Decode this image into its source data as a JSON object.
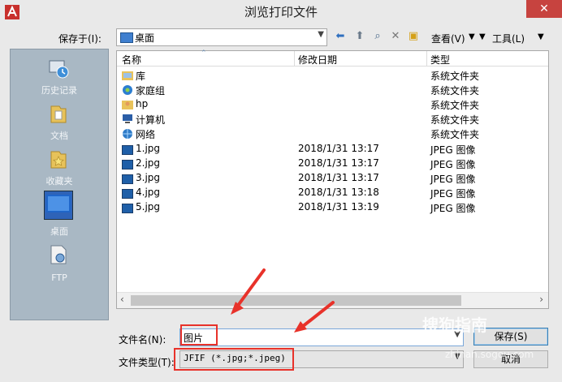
{
  "window": {
    "title": "浏览打印文件",
    "close_glyph": "✕"
  },
  "toolbar": {
    "save_in_label": "保存于(I):",
    "save_in_value": "桌面",
    "view_label": "查看(V)",
    "tools_label": "工具(L)",
    "icons": [
      "back-icon",
      "up-folder-icon",
      "search-web-icon",
      "delete-icon",
      "new-folder-icon"
    ]
  },
  "places": [
    {
      "label": "历史记录",
      "icon": "history-icon"
    },
    {
      "label": "文档",
      "icon": "documents-folder-icon"
    },
    {
      "label": "收藏夹",
      "icon": "favorites-folder-icon"
    },
    {
      "label": "桌面",
      "icon": "desktop-icon",
      "selected": true
    },
    {
      "label": "FTP",
      "icon": "ftp-icon"
    }
  ],
  "filelist": {
    "columns": [
      "名称",
      "修改日期",
      "类型"
    ],
    "rows": [
      {
        "name": "库",
        "date": "",
        "type": "系统文件夹",
        "icon": "library-icon"
      },
      {
        "name": "家庭组",
        "date": "",
        "type": "系统文件夹",
        "icon": "homegroup-icon"
      },
      {
        "name": "hp",
        "date": "",
        "type": "系统文件夹",
        "icon": "user-folder-icon"
      },
      {
        "name": "计算机",
        "date": "",
        "type": "系统文件夹",
        "icon": "computer-icon"
      },
      {
        "name": "网络",
        "date": "",
        "type": "系统文件夹",
        "icon": "network-icon"
      },
      {
        "name": "1.jpg",
        "date": "2018/1/31 13:17",
        "type": "JPEG 图像",
        "icon": "jpeg-icon"
      },
      {
        "name": "2.jpg",
        "date": "2018/1/31 13:17",
        "type": "JPEG 图像",
        "icon": "jpeg-icon"
      },
      {
        "name": "3.jpg",
        "date": "2018/1/31 13:17",
        "type": "JPEG 图像",
        "icon": "jpeg-icon"
      },
      {
        "name": "4.jpg",
        "date": "2018/1/31 13:18",
        "type": "JPEG 图像",
        "icon": "jpeg-icon"
      },
      {
        "name": "5.jpg",
        "date": "2018/1/31 13:19",
        "type": "JPEG 图像",
        "icon": "jpeg-icon"
      }
    ]
  },
  "form": {
    "filename_label": "文件名(N):",
    "filename_value": "图片",
    "filetype_label": "文件类型(T):",
    "filetype_value": "JFIF (*.jpg;*.jpeg)",
    "save_button": "保存(S)",
    "cancel_button": "取消"
  },
  "watermark": {
    "text": "搜狗指南",
    "sub": "zhinan.sogou.com"
  },
  "colors": {
    "annotation_red": "#e8322a",
    "close_red": "#c7433f",
    "places_bg": "#a9b8c4"
  }
}
